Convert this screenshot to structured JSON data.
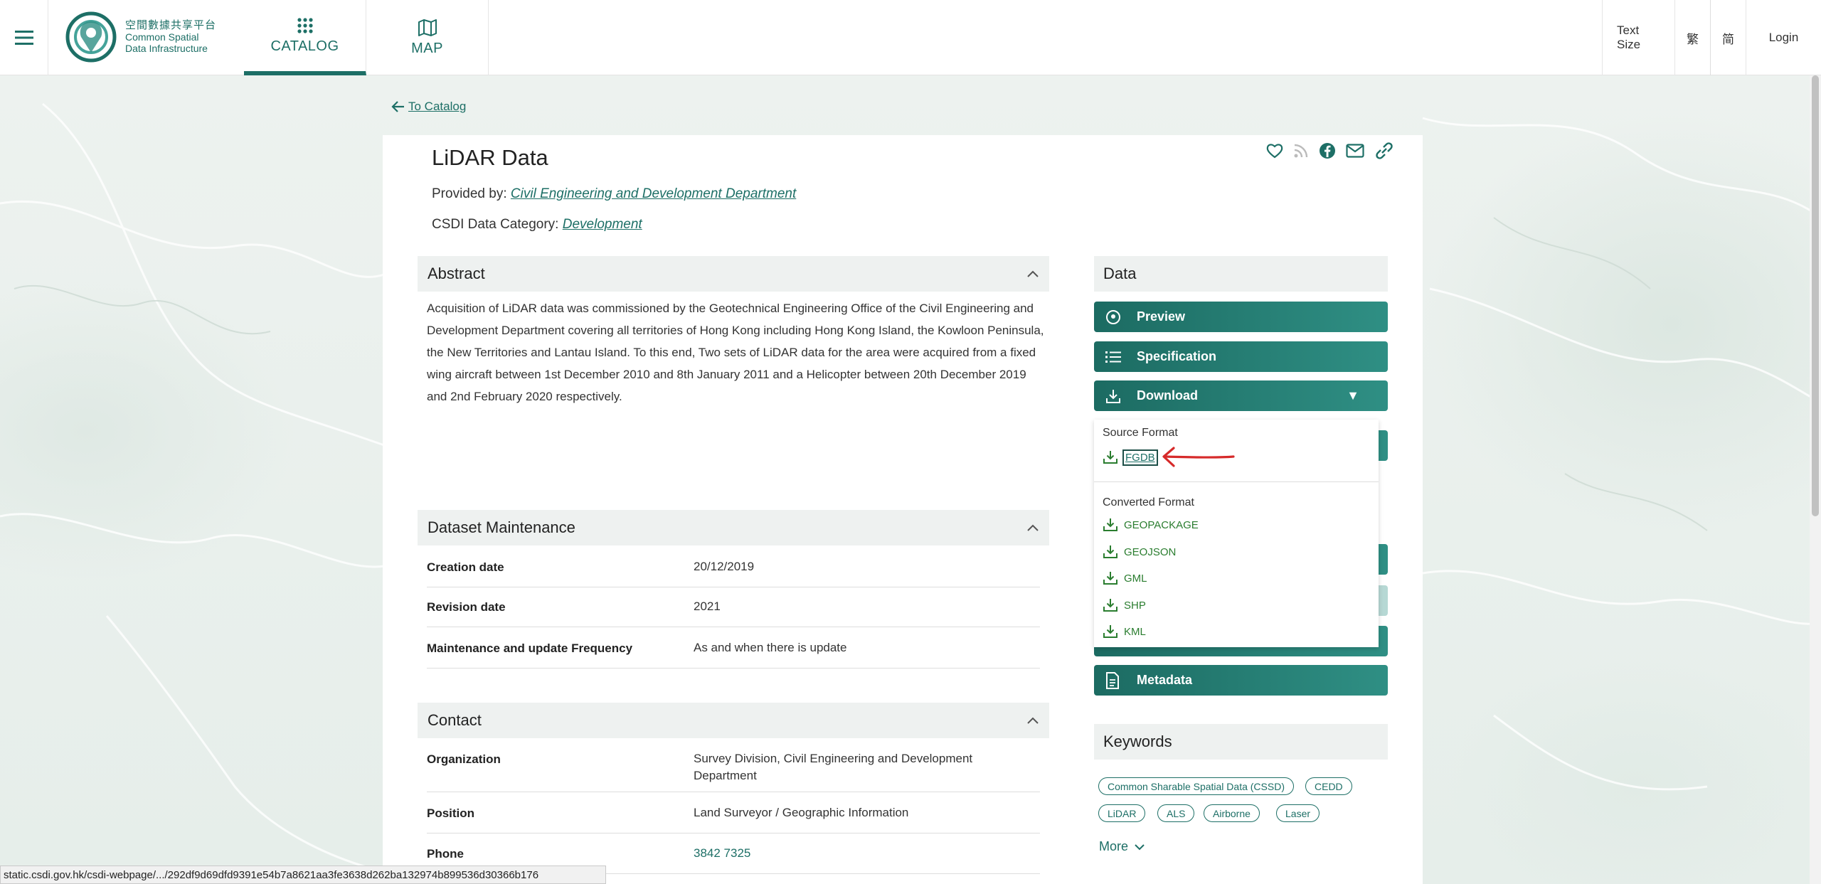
{
  "header": {
    "logo_cn": "空間數據共享平台",
    "logo_en_line1": "Common Spatial",
    "logo_en_line2": "Data Infrastructure",
    "tabs": [
      {
        "label": "CATALOG",
        "icon": "grid-icon",
        "active": true
      },
      {
        "label": "MAP",
        "icon": "map-icon",
        "active": false
      }
    ],
    "text_size": "Text Size",
    "lang_trad": "繁",
    "lang_simp": "简",
    "login": "Login"
  },
  "back_link": "To Catalog",
  "dataset": {
    "title": "LiDAR Data",
    "provided_by_label": "Provided by:",
    "provider": "Civil Engineering and Development Department",
    "category_label": "CSDI Data Category:",
    "category": "Development"
  },
  "abstract": {
    "heading": "Abstract",
    "text": "Acquisition of LiDAR data was commissioned by the Geotechnical Engineering Office of the Civil Engineering and Development Department covering all territories of Hong Kong including Hong Kong Island, the Kowloon Peninsula, the New Territories and Lantau Island. To this end, Two sets of LiDAR data for the area were acquired from a fixed wing aircraft between 1st December 2010 and 8th January 2011 and a Helicopter between 20th December 2019 and 2nd February 2020 respectively."
  },
  "maintenance": {
    "heading": "Dataset Maintenance",
    "rows": [
      {
        "key": "Creation date",
        "value": "20/12/2019"
      },
      {
        "key": "Revision date",
        "value": "2021"
      },
      {
        "key": "Maintenance and update Frequency",
        "value": "As and when there is update"
      }
    ]
  },
  "contact": {
    "heading": "Contact",
    "rows": [
      {
        "key": "Organization",
        "value": "Survey Division, Civil Engineering and Development Department"
      },
      {
        "key": "Position",
        "value": "Land Surveyor / Geographic Information"
      },
      {
        "key": "Phone",
        "value": "3842 7325"
      }
    ]
  },
  "data_panel": {
    "heading": "Data",
    "preview": "Preview",
    "specification": "Specification",
    "download": "Download",
    "caret": "▼",
    "metadata": "Metadata"
  },
  "download_menu": {
    "source_label": "Source Format",
    "source_items": [
      "FGDB"
    ],
    "converted_label": "Converted Format",
    "converted_items": [
      "GEOPACKAGE",
      "GEOJSON",
      "GML",
      "SHP",
      "KML"
    ]
  },
  "keywords": {
    "heading": "Keywords",
    "items": [
      "Common Sharable Spatial Data (CSSD)",
      "CEDD",
      "LiDAR",
      "ALS",
      "Airborne",
      "Laser"
    ],
    "more": "More"
  },
  "status_url": "static.csdi.gov.hk/csdi-webpage/.../292df9d69dfd9391e54b7a8621aa3fe3638d262ba132974b899536d30366b176",
  "colors": {
    "accent": "#1d6f66",
    "annotation_arrow": "#d62a2a"
  }
}
